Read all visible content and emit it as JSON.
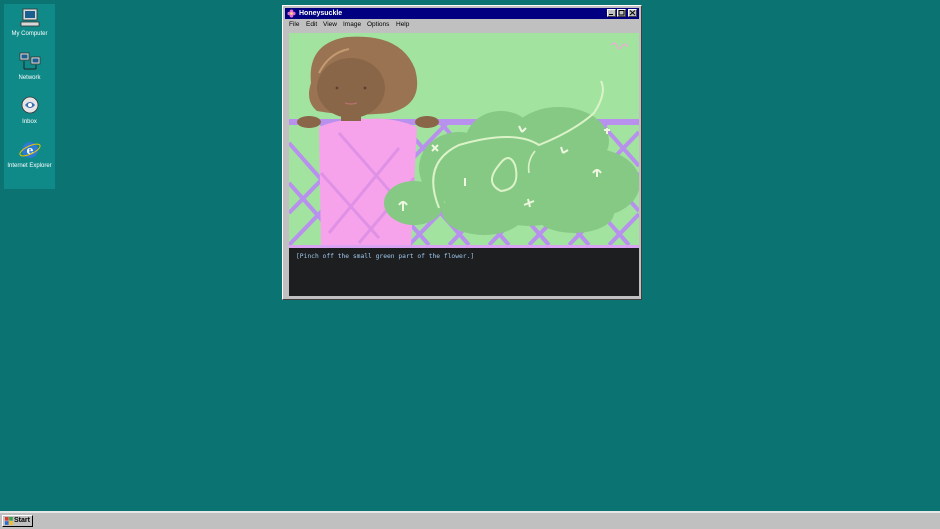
{
  "desktop": {
    "icons": [
      {
        "label": "My Computer",
        "icon": "my-computer-icon"
      },
      {
        "label": "Network",
        "icon": "network-icon"
      },
      {
        "label": "Inbox",
        "icon": "inbox-icon"
      },
      {
        "label": "Internet Explorer",
        "icon": "internet-explorer-icon"
      }
    ]
  },
  "window": {
    "title": "Honeysuckle",
    "menu": [
      "File",
      "Edit",
      "View",
      "Image",
      "Options",
      "Help"
    ],
    "caption": "[Pinch off the small green part of the flower.]"
  },
  "taskbar": {
    "start_label": "Start"
  },
  "colors": {
    "desktop": "#0b7472",
    "titlebar": "#000080",
    "scene_background": "#a2e3a0",
    "lattice": "#b890ee",
    "shirt": "#f7a3ec",
    "bush": "#86c985",
    "text_panel": "#1c1e20",
    "caption_text": "#9fc7ec"
  }
}
